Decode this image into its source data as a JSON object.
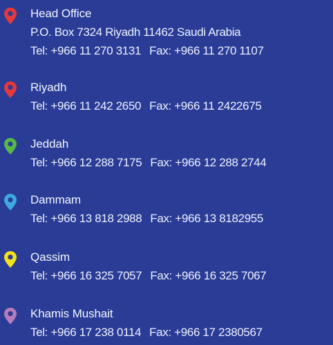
{
  "offices": [
    {
      "name": "Head Office",
      "address": "P.O. Box 7324  Riyadh 11462 Saudi Arabia",
      "tel": "Tel: +966 11 270 3131",
      "fax": "Fax: +966 11 270 1107",
      "pin_color": "#e5393b",
      "icon": "map-pin-icon"
    },
    {
      "name": "Riyadh",
      "tel": "Tel: +966 11 242 2650",
      "fax": "Fax: +966 11 2422675",
      "pin_color": "#e5393b",
      "icon": "map-pin-icon"
    },
    {
      "name": "Jeddah",
      "tel": "Tel: +966 12 288 7175",
      "fax": "Fax: +966 12 288 2744",
      "pin_color": "#56b947",
      "icon": "map-pin-icon"
    },
    {
      "name": "Dammam",
      "tel": "Tel: +966 13 818 2988",
      "fax": "Fax: +966 13 8182955",
      "pin_color": "#3fa9e0",
      "icon": "map-pin-icon"
    },
    {
      "name": "Qassim",
      "tel": "Tel: +966 16 325 7057",
      "fax": "Fax: +966 16 325 7067",
      "pin_color": "#f2e21b",
      "icon": "map-pin-icon"
    },
    {
      "name": "Khamis Mushait",
      "tel": "Tel: +966 17 238  0114",
      "fax": "Fax: +966 17 2380567",
      "pin_color": "#b77dba",
      "icon": "map-pin-icon"
    }
  ]
}
